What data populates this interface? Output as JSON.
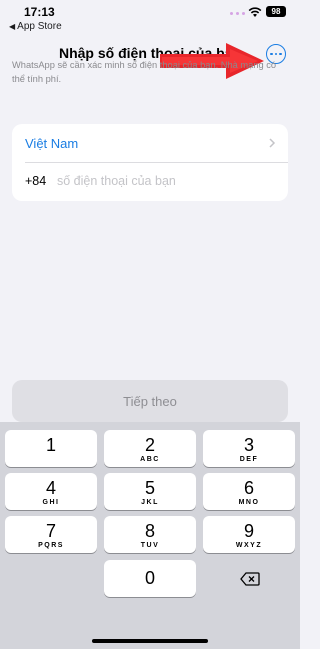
{
  "status_bar": {
    "time": "17:13",
    "back_app": "App Store",
    "battery": "98"
  },
  "header": {
    "title": "Nhập số điện thoại của bạn",
    "more_icon": "ellipsis-circle-icon",
    "accent_color": "#1a7de3"
  },
  "description": "WhatsApp sẽ cần xác minh số điện thoại của bạn. Nhà mạng có thể tính phí.",
  "form": {
    "country": "Việt Nam",
    "country_code": "+84",
    "phone_placeholder": "số điện thoại của bạn",
    "phone_value": ""
  },
  "next_button": "Tiếp theo",
  "keyboard": {
    "keys": [
      {
        "num": "1",
        "letters": ""
      },
      {
        "num": "2",
        "letters": "ABC"
      },
      {
        "num": "3",
        "letters": "DEF"
      },
      {
        "num": "4",
        "letters": "GHI"
      },
      {
        "num": "5",
        "letters": "JKL"
      },
      {
        "num": "6",
        "letters": "MNO"
      },
      {
        "num": "7",
        "letters": "PQRS"
      },
      {
        "num": "8",
        "letters": "TUV"
      },
      {
        "num": "9",
        "letters": "WXYZ"
      },
      {
        "num": "0",
        "letters": ""
      }
    ],
    "delete_icon": "backspace-icon"
  },
  "annotation_color": "#e8262b"
}
